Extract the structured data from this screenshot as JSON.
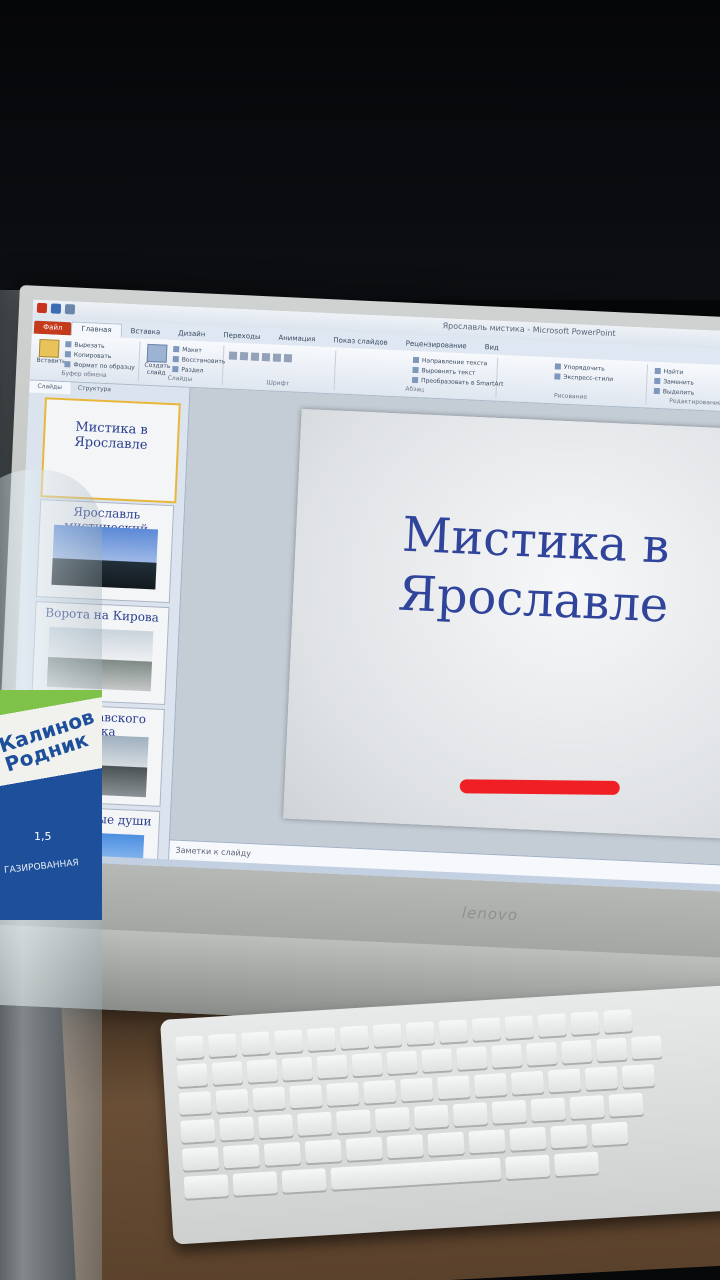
{
  "window": {
    "title": "Ярославль мистика - Microsoft PowerPoint"
  },
  "ribbon_tabs": [
    "Файл",
    "Главная",
    "Вставка",
    "Дизайн",
    "Переходы",
    "Анимация",
    "Показ слайдов",
    "Рецензирование",
    "Вид"
  ],
  "ribbon": {
    "paste_label": "Вставить",
    "cut_label": "Вырезать",
    "copy_label": "Копировать",
    "format_label": "Формат по образцу",
    "clipboard_caption": "Буфер обмена",
    "new_slide_label": "Создать слайд",
    "layout_label": "Макет",
    "reset_label": "Восстановить",
    "section_label": "Раздел",
    "slides_caption": "Слайды",
    "font_caption": "Шрифт",
    "paragraph_caption": "Абзац",
    "text_direction_label": "Направление текста",
    "align_text_label": "Выровнять текст",
    "smartart_label": "Преобразовать в SmartArt",
    "arrange_label": "Упорядочить",
    "quick_styles_label": "Экспресс-стили",
    "drawing_caption": "Рисование",
    "find_label": "Найти",
    "replace_label": "Заменить",
    "select_label": "Выделить",
    "editing_caption": "Редактирование"
  },
  "panel_tabs": [
    "Слайды",
    "Структура"
  ],
  "thumbnails": [
    {
      "number": "1",
      "title": "Мистика в Ярославле"
    },
    {
      "number": "2",
      "title": "Ярославль мистический"
    },
    {
      "number": "3",
      "title": "Ворота на Кирова"
    },
    {
      "number": "4",
      "title": "Холм-...авского парка"
    },
    {
      "number": "5",
      "title": "...мосостные души"
    }
  ],
  "slide": {
    "title_line1": "Мистика в",
    "title_line2": "Ярославле"
  },
  "notes_placeholder": "Заметки к слайду",
  "monitor_brand": "lenovo",
  "bottle": {
    "brand": "Калинов Родник",
    "volume": "1,5",
    "type": "ГАЗИРОВАННАЯ"
  },
  "colors": {
    "slide_title": "#2f449a",
    "file_tab": "#c43b1c",
    "red_mark": "#ef1f23"
  }
}
